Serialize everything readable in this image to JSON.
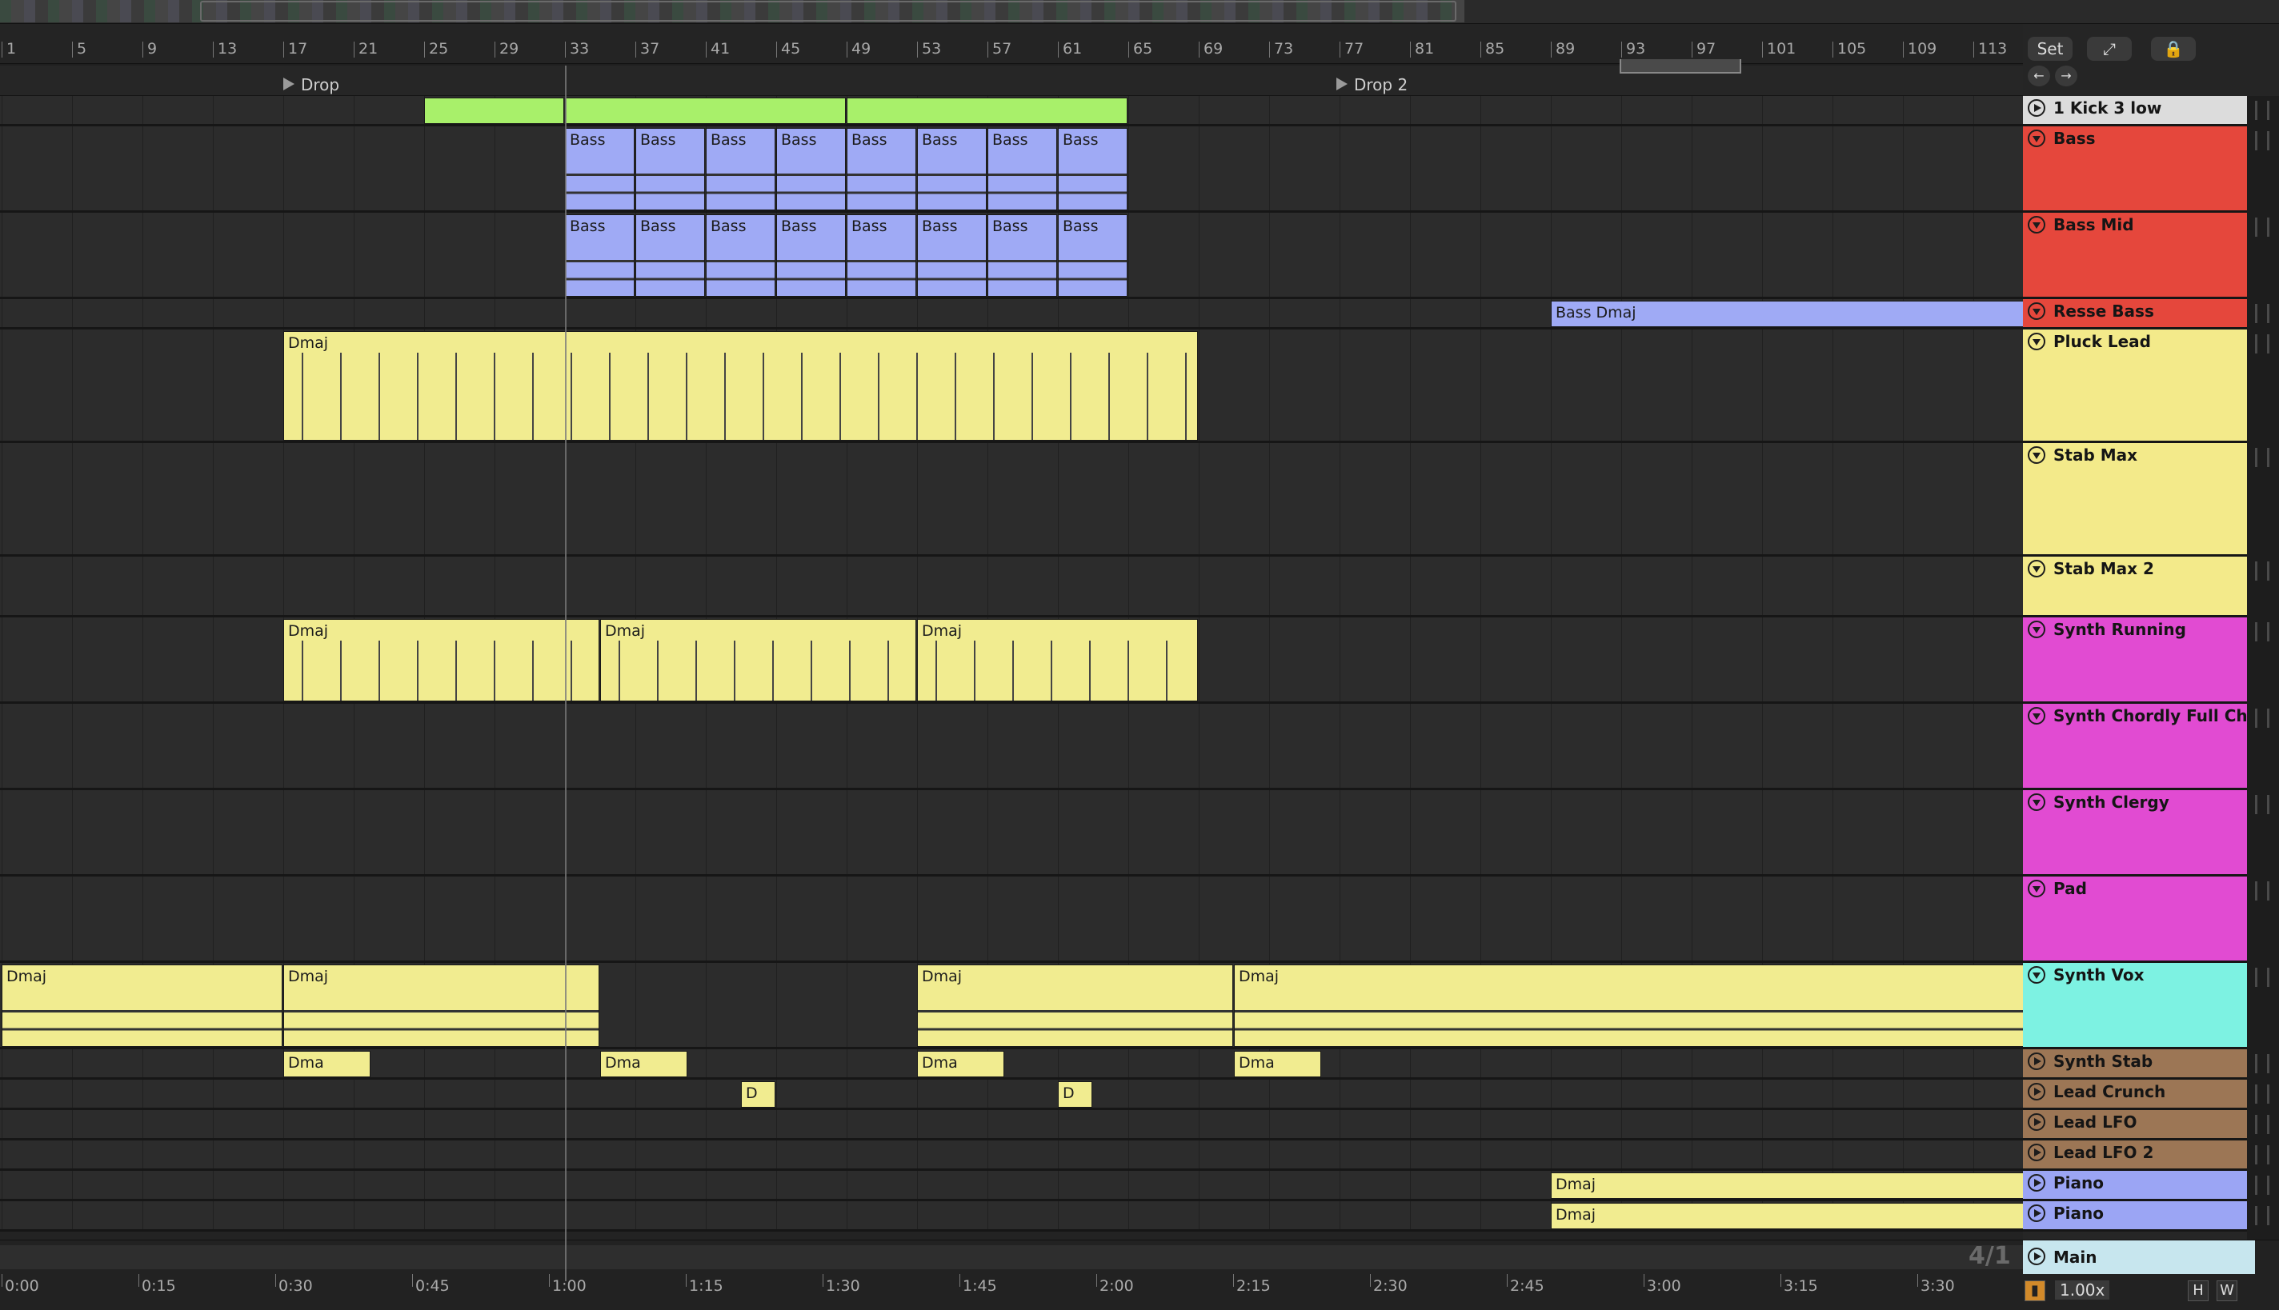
{
  "colors": {
    "green_clip": "#a8f06a",
    "blue_clip": "#9faaf5",
    "yellow_clip": "#f1ec90",
    "red_track": "#e5473c",
    "yellow_track": "#f3ea8a",
    "magenta_track": "#e14bd2",
    "cyan_track": "#7df2e2",
    "brown_track": "#9c7655",
    "blue_track": "#9ba5f4",
    "main_track": "#c7e6ee"
  },
  "ruler": {
    "bars": [
      "1",
      "5",
      "9",
      "13",
      "17",
      "21",
      "25",
      "29",
      "33",
      "37",
      "41",
      "45",
      "49",
      "53",
      "57",
      "61",
      "65",
      "69",
      "73",
      "77",
      "81",
      "85",
      "89",
      "93",
      "97",
      "101",
      "105",
      "109",
      "113"
    ]
  },
  "locators": [
    {
      "name": "Drop"
    },
    {
      "name": "Drop 2"
    }
  ],
  "topright": {
    "set_label": "Set"
  },
  "tracks": [
    {
      "name": "1 Kick 3 low",
      "icon": "play-icon"
    },
    {
      "name": "Bass",
      "icon": "fold-icon"
    },
    {
      "name": "Bass Mid",
      "icon": "fold-icon"
    },
    {
      "name": "Resse Bass",
      "icon": "fold-icon"
    },
    {
      "name": "Pluck Lead",
      "icon": "fold-icon"
    },
    {
      "name": "Stab Max",
      "icon": "fold-icon"
    },
    {
      "name": "Stab Max 2",
      "icon": "fold-icon"
    },
    {
      "name": "Synth Running",
      "icon": "fold-icon"
    },
    {
      "name": "Synth Chordly Full Cho",
      "icon": "fold-icon"
    },
    {
      "name": "Synth Clergy",
      "icon": "fold-icon"
    },
    {
      "name": "Pad",
      "icon": "fold-icon"
    },
    {
      "name": "Synth Vox",
      "icon": "fold-icon"
    },
    {
      "name": "Synth Stab",
      "icon": "play-icon"
    },
    {
      "name": "Lead Crunch",
      "icon": "play-icon"
    },
    {
      "name": "Lead LFO",
      "icon": "play-icon"
    },
    {
      "name": "Lead LFO 2",
      "icon": "play-icon"
    },
    {
      "name": "Piano",
      "icon": "play-icon"
    },
    {
      "name": "Piano",
      "icon": "play-icon"
    }
  ],
  "clip_names": {
    "bass_short": "Bass",
    "bass_dmaj": "Bass Dmaj",
    "dmaj": "Dmaj",
    "dma": "Dma",
    "d": "D"
  },
  "bottom": {
    "main_label": "Main",
    "fraction": "4/1",
    "zoom": "1.00x",
    "h_label": "H",
    "w_label": "W",
    "times": [
      "0:00",
      "0:15",
      "0:30",
      "0:45",
      "1:00",
      "1:15",
      "1:30",
      "1:45",
      "2:00",
      "2:15",
      "2:30",
      "2:45",
      "3:00",
      "3:15",
      "3:30"
    ]
  }
}
